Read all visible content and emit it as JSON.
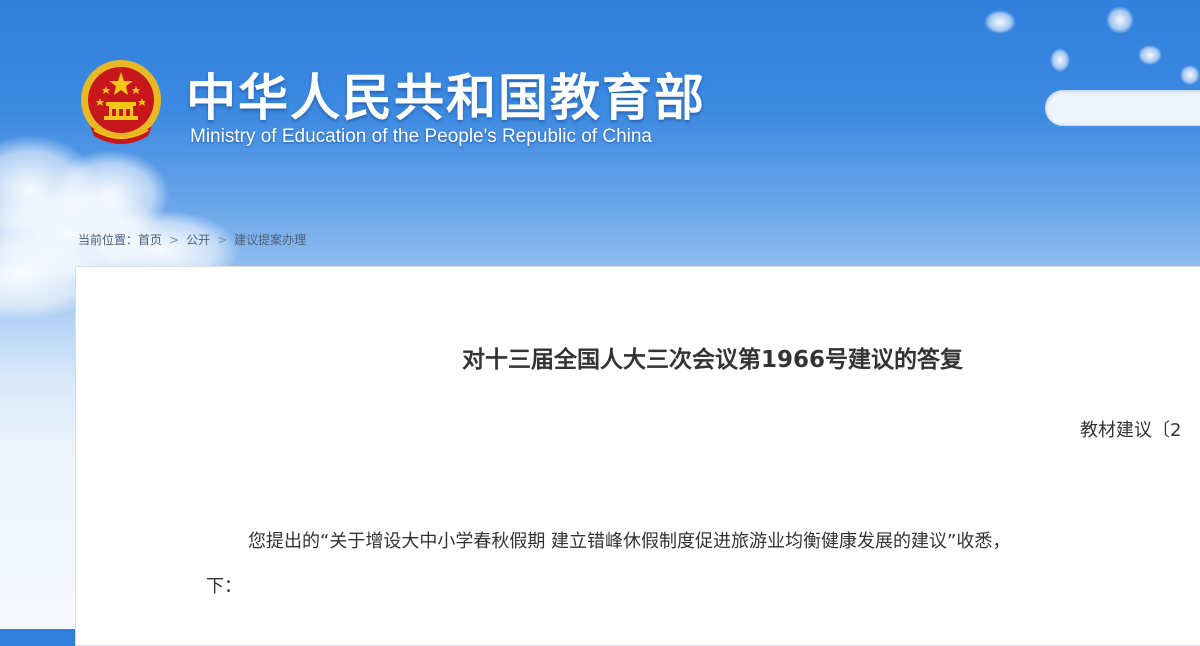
{
  "header": {
    "title_cn": "中华人民共和国教育部",
    "title_en": "Ministry of Education of the People's Republic of China",
    "emblem_icon": "national-emblem-icon"
  },
  "search": {
    "value": "",
    "placeholder": ""
  },
  "breadcrumb": {
    "prefix": "当前位置：",
    "items": [
      {
        "label": "首页"
      },
      {
        "label": "公开"
      },
      {
        "label": "建议提案办理"
      }
    ],
    "separator": ">"
  },
  "article": {
    "title": "对十三届全国人大三次会议第1966号建议的答复",
    "doc_number": "教材建议〔2",
    "paragraph_line1": "您提出的“关于增设大中小学春秋假期 建立错峰休假制度促进旅游业均衡健康发展的建议”收悉，",
    "paragraph_line2": "下："
  },
  "colors": {
    "header_blue": "#2f7fdc",
    "emblem_red": "#c8161d",
    "emblem_gold": "#f5c518",
    "text_dark": "#333333"
  }
}
